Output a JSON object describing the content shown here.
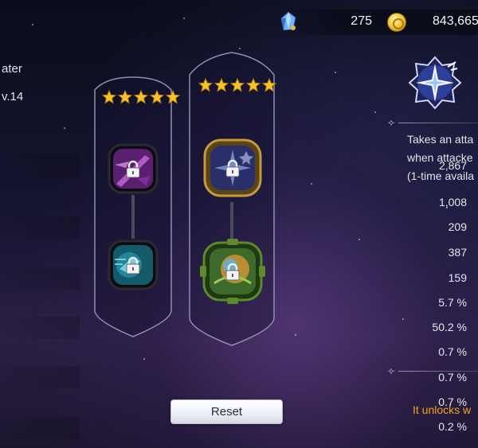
{
  "currency": {
    "crystal_icon": "crystal-icon",
    "crystal_count": "275",
    "gold_icon": "gold-coin-icon",
    "gold_count": "843,665"
  },
  "left_panel": {
    "name_fragment": "ater",
    "level_fragment": "v.14",
    "stats": [
      "2,867",
      "1,008",
      "209",
      "387",
      "159",
      "5.7 %",
      "50.2 %",
      "0.7 %",
      "0.7 %",
      "0.7 %",
      "0.2 %"
    ]
  },
  "trees": [
    {
      "stars": 5,
      "nodes": [
        {
          "icon": "purple-sword-skill-icon",
          "locked": true
        },
        {
          "icon": "teal-runner-skill-icon",
          "locked": true
        }
      ]
    },
    {
      "stars": 5,
      "nodes": [
        {
          "icon": "blue-star-skill-icon",
          "locked": true
        },
        {
          "icon": "green-orb-skill-icon",
          "locked": true
        }
      ]
    }
  ],
  "skill_info": {
    "emblem_icon": "star-burst-emblem-icon",
    "description": [
      "Takes an atta",
      "when attacke",
      "(1-time availa"
    ],
    "unlock_note": "It unlocks w"
  },
  "reset_label": "Reset",
  "colors": {
    "accent_orange": "#f3a21c",
    "star_gold": "#f6c22c",
    "panel_border": "#8e8fb4"
  }
}
